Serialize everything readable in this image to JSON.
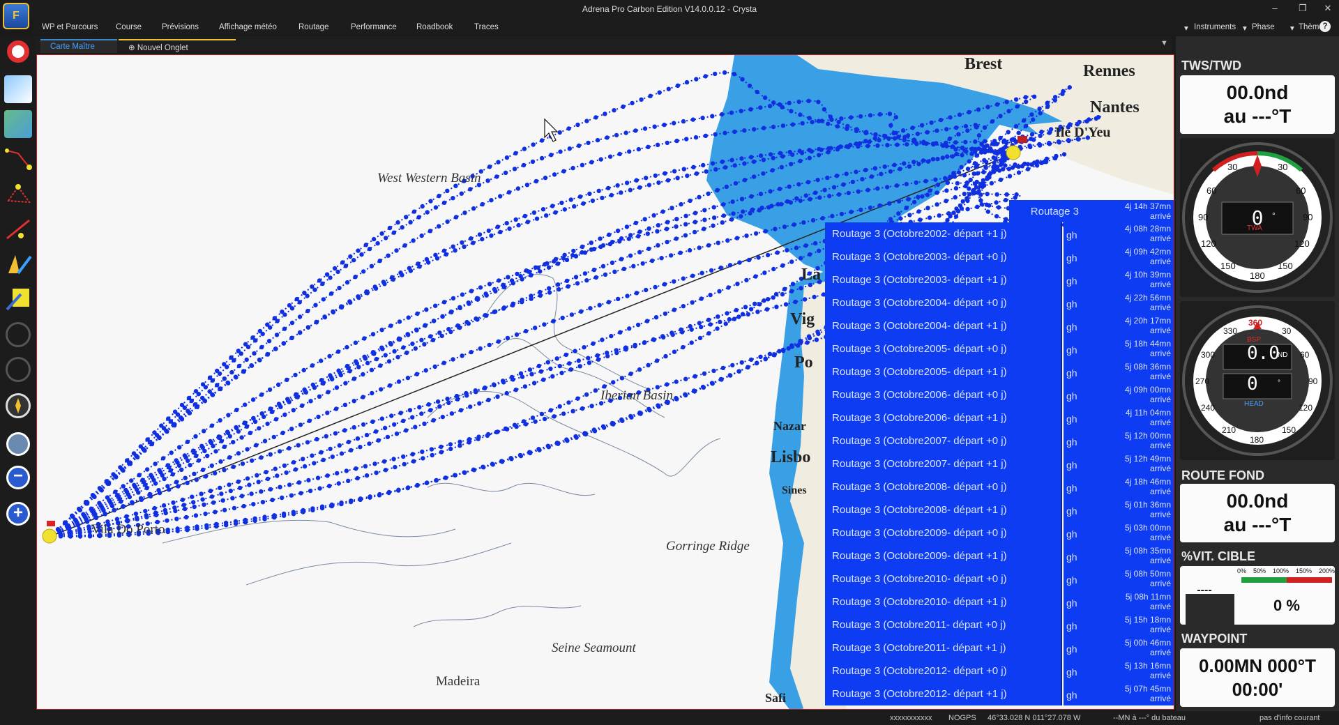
{
  "window": {
    "title": "Adrena Pro Carbon Edition V14.0.0.12 - Crysta",
    "logo_letter": "F"
  },
  "menu": [
    "WP et Parcours",
    "Course",
    "Prévisions",
    "Affichage météo",
    "Routage",
    "Performance",
    "Roadbook",
    "Traces"
  ],
  "right_menu": {
    "instruments": "Instruments",
    "phase": "Phase",
    "theme": "Thème",
    "help": "?"
  },
  "tabs": {
    "active": "Carte Maître",
    "new": "Nouvel Onglet"
  },
  "map": {
    "labels": {
      "brest": "Brest",
      "rennes": "Rennes",
      "nantes": "Nantes",
      "ile_dyeu": "Ile D'Yeu",
      "west_basin": "West Western Basin",
      "iberian": "Iberian Basin",
      "gorringe": "Gorringe Ridge",
      "seine": "Seine Seamount",
      "madeira": "Madeira",
      "vila": "Vila Do Porto",
      "la": "La",
      "vig": "Vig",
      "po": "Po",
      "nazar": "Nazar",
      "lisb": "Lisbo",
      "sines": "Sines",
      "safi": "Safi"
    },
    "routing_header": "Routage 3",
    "routings": [
      {
        "name": "Routage 3 (Octobre2002- départ +1 j)",
        "gh": "gh",
        "time": "4j 14h 37mn",
        "status": "arrivé"
      },
      {
        "name": "Routage 3 (Octobre2003- départ +0 j)",
        "gh": "gh",
        "time": "4j 08h 28mn",
        "status": "arrivé"
      },
      {
        "name": "Routage 3 (Octobre2003- départ +1 j)",
        "gh": "gh",
        "time": "4j 09h 42mn",
        "status": "arrivé"
      },
      {
        "name": "Routage 3 (Octobre2004- départ +0 j)",
        "gh": "gh",
        "time": "4j 10h 39mn",
        "status": "arrivé"
      },
      {
        "name": "Routage 3 (Octobre2004- départ +1 j)",
        "gh": "gh",
        "time": "4j 22h 56mn",
        "status": "arrivé"
      },
      {
        "name": "Routage 3 (Octobre2005- départ +0 j)",
        "gh": "gh",
        "time": "4j 20h 17mn",
        "status": "arrivé"
      },
      {
        "name": "Routage 3 (Octobre2005- départ +1 j)",
        "gh": "gh",
        "time": "5j 18h 44mn",
        "status": "arrivé"
      },
      {
        "name": "Routage 3 (Octobre2006- départ +0 j)",
        "gh": "gh",
        "time": "5j 08h 36mn",
        "status": "arrivé"
      },
      {
        "name": "Routage 3 (Octobre2006- départ +1 j)",
        "gh": "gh",
        "time": "4j 09h 00mn",
        "status": "arrivé"
      },
      {
        "name": "Routage 3 (Octobre2007- départ +0 j)",
        "gh": "gh",
        "time": "4j 11h 04mn",
        "status": "arrivé"
      },
      {
        "name": "Routage 3 (Octobre2007- départ +1 j)",
        "gh": "gh",
        "time": "5j 12h 00mn",
        "status": "arrivé"
      },
      {
        "name": "Routage 3 (Octobre2008- départ +0 j)",
        "gh": "gh",
        "time": "5j 12h 49mn",
        "status": "arrivé"
      },
      {
        "name": "Routage 3 (Octobre2008- départ +1 j)",
        "gh": "gh",
        "time": "4j 18h 46mn",
        "status": "arrivé"
      },
      {
        "name": "Routage 3 (Octobre2009- départ +0 j)",
        "gh": "gh",
        "time": "5j 01h 36mn",
        "status": "arrivé"
      },
      {
        "name": "Routage 3 (Octobre2009- départ +1 j)",
        "gh": "gh",
        "time": "5j 03h 00mn",
        "status": "arrivé"
      },
      {
        "name": "Routage 3 (Octobre2010- départ +0 j)",
        "gh": "gh",
        "time": "5j 08h 35mn",
        "status": "arrivé"
      },
      {
        "name": "Routage 3 (Octobre2010- départ +1 j)",
        "gh": "gh",
        "time": "5j 08h 50mn",
        "status": "arrivé"
      },
      {
        "name": "Routage 3 (Octobre2011- départ +0 j)",
        "gh": "gh",
        "time": "5j 08h 11mn",
        "status": "arrivé"
      },
      {
        "name": "Routage 3 (Octobre2011- départ +1 j)",
        "gh": "gh",
        "time": "5j 15h 18mn",
        "status": "arrivé"
      },
      {
        "name": "Routage 3 (Octobre2012- départ +0 j)",
        "gh": "gh",
        "time": "5j 00h 46mn",
        "status": "arrivé"
      },
      {
        "name": "Routage 3 (Octobre2012- départ +1 j)",
        "gh": "gh",
        "time": "5j 13h 16mn",
        "status": "arrivé"
      }
    ],
    "last_time": "5j 07h 45mn",
    "last_status": "arrivé"
  },
  "instruments": {
    "tws": {
      "title": "TWS/TWD",
      "line1": "00.0nd",
      "line2": "au ---°T"
    },
    "twa_gauge": {
      "label": "TWA",
      "value": "0",
      "unit": "°",
      "ticks": [
        "30",
        "30",
        "60",
        "60",
        "90",
        "90",
        "120",
        "120",
        "150",
        "150",
        "180"
      ]
    },
    "bsp_gauge": {
      "label_bsp": "BSP",
      "label_head": "HEAD",
      "value_bsp": "0.0",
      "unit_bsp": "ND",
      "value_head": "0",
      "unit_head": "°",
      "ticks": [
        "360",
        "330",
        "30",
        "300",
        "60",
        "270",
        "90",
        "240",
        "120",
        "210",
        "150",
        "180"
      ]
    },
    "route_fond": {
      "title": "ROUTE FOND",
      "line1": "00.0nd",
      "line2": "au ---°T"
    },
    "vit_cible": {
      "title": "%VIT. CIBLE",
      "left": "----",
      "value": "0 %",
      "scale": [
        "0%",
        "50%",
        "100%",
        "150%",
        "200%"
      ]
    },
    "waypoint": {
      "title": "WAYPOINT",
      "line1": "0.00MN 000°T",
      "line2": "00:00'"
    }
  },
  "status": {
    "a": "xxxxxxxxxxx",
    "gps": "NOGPS",
    "pos": "46°33.028 N  011°27.078 W",
    "mn": "--MN à ---° du bateau",
    "info": "pas d'info courant"
  },
  "colors": {
    "route": "#1030e0",
    "list_bg": "#0d3cf2",
    "land": "#f1ece0",
    "sea_shallow": "#3aa0e6"
  }
}
